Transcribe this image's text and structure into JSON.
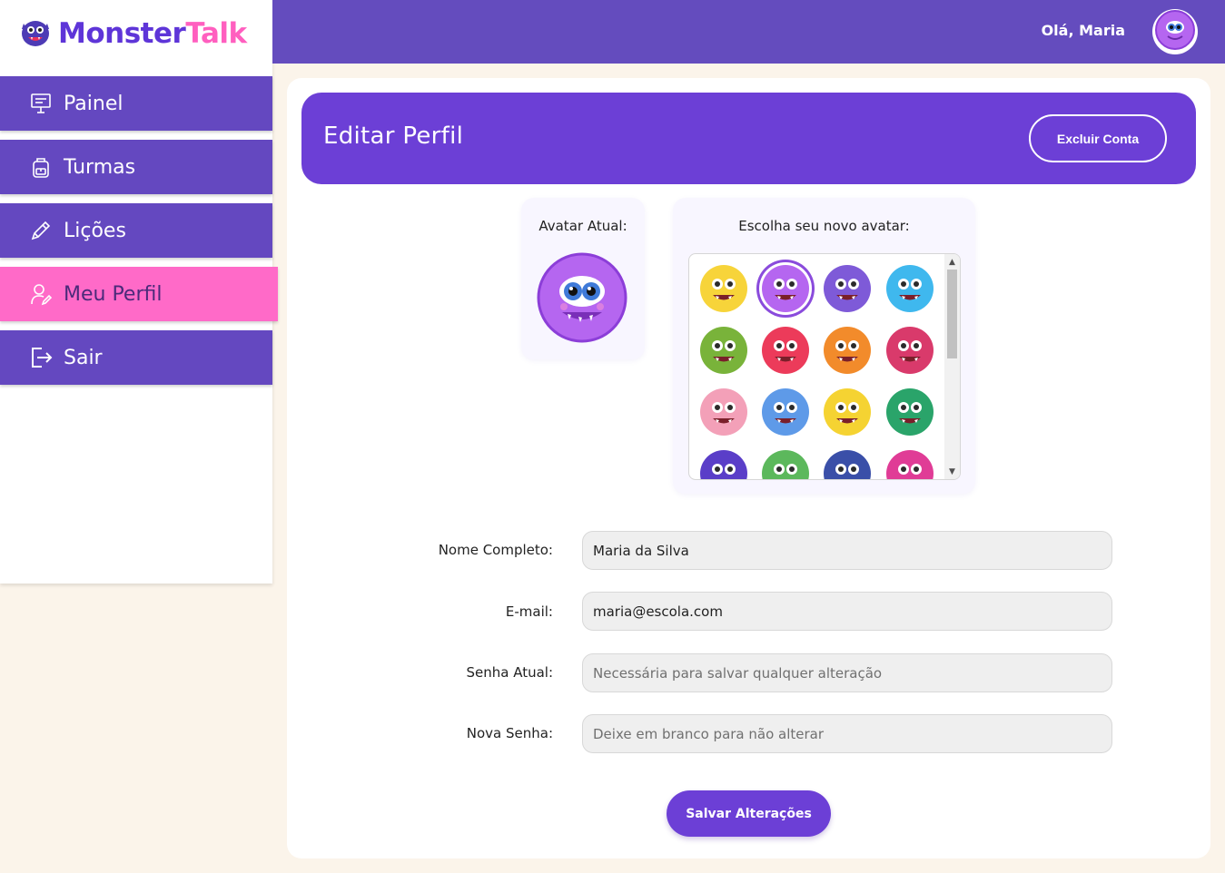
{
  "brand": {
    "name_part1": "Monster",
    "name_part2": "Talk",
    "logo_icon": "monster-logo-icon"
  },
  "sidebar": {
    "items": [
      {
        "label": "Painel",
        "icon": "presentation-board-icon",
        "active": false
      },
      {
        "label": "Turmas",
        "icon": "backpack-icon",
        "active": false
      },
      {
        "label": "Lições",
        "icon": "pencil-icon",
        "active": false
      },
      {
        "label": "Meu Perfil",
        "icon": "user-edit-icon",
        "active": true
      },
      {
        "label": "Sair",
        "icon": "logout-icon",
        "active": false
      }
    ]
  },
  "header": {
    "greeting": "Olá, Maria",
    "avatar": "purple-monster-avatar-icon"
  },
  "page": {
    "title": "Editar Perfil",
    "delete_button": "Excluir Conta",
    "current_avatar_label": "Avatar Atual:",
    "choose_avatar_label": "Escolha seu novo avatar:",
    "avatars": [
      {
        "name": "yellow-monster",
        "color": "#f7d43a",
        "selected": false
      },
      {
        "name": "purple-monster",
        "color": "#b566f0",
        "selected": true
      },
      {
        "name": "violet-cyclops",
        "color": "#7e5ad8",
        "selected": false
      },
      {
        "name": "blue-monster",
        "color": "#3fb8ee",
        "selected": false
      },
      {
        "name": "green-monster",
        "color": "#79b33a",
        "selected": false
      },
      {
        "name": "red-monster",
        "color": "#ec3b5a",
        "selected": false
      },
      {
        "name": "orange-monster",
        "color": "#f28b2b",
        "selected": false
      },
      {
        "name": "magenta-monster",
        "color": "#d93a6b",
        "selected": false
      },
      {
        "name": "pink-monster",
        "color": "#f3a0b8",
        "selected": false
      },
      {
        "name": "sky-monster",
        "color": "#5e9ae8",
        "selected": false
      },
      {
        "name": "crying-yellow-monster",
        "color": "#f5d332",
        "selected": false
      },
      {
        "name": "teal-monster",
        "color": "#2aa46a",
        "selected": false
      },
      {
        "name": "bat-monster",
        "color": "#5a3ec8",
        "selected": false
      },
      {
        "name": "fuzzy-green-monster",
        "color": "#5cb85c",
        "selected": false
      },
      {
        "name": "tall-blue-monster",
        "color": "#3a4fa8",
        "selected": false
      },
      {
        "name": "spiky-pink-monster",
        "color": "#e03c96",
        "selected": false
      }
    ],
    "form": {
      "name_label": "Nome Completo:",
      "name_value": "Maria da Silva",
      "email_label": "E-mail:",
      "email_value": "maria@escola.com",
      "current_password_label": "Senha Atual:",
      "current_password_placeholder": "Necessária para salvar qualquer alteração",
      "new_password_label": "Nova Senha:",
      "new_password_placeholder": "Deixe em branco para não alterar"
    },
    "save_button": "Salvar Alterações"
  },
  "colors": {
    "primary": "#6c3fd6",
    "nav": "#6448c0",
    "active": "#ff6ac8",
    "background": "#fbf4ea"
  }
}
